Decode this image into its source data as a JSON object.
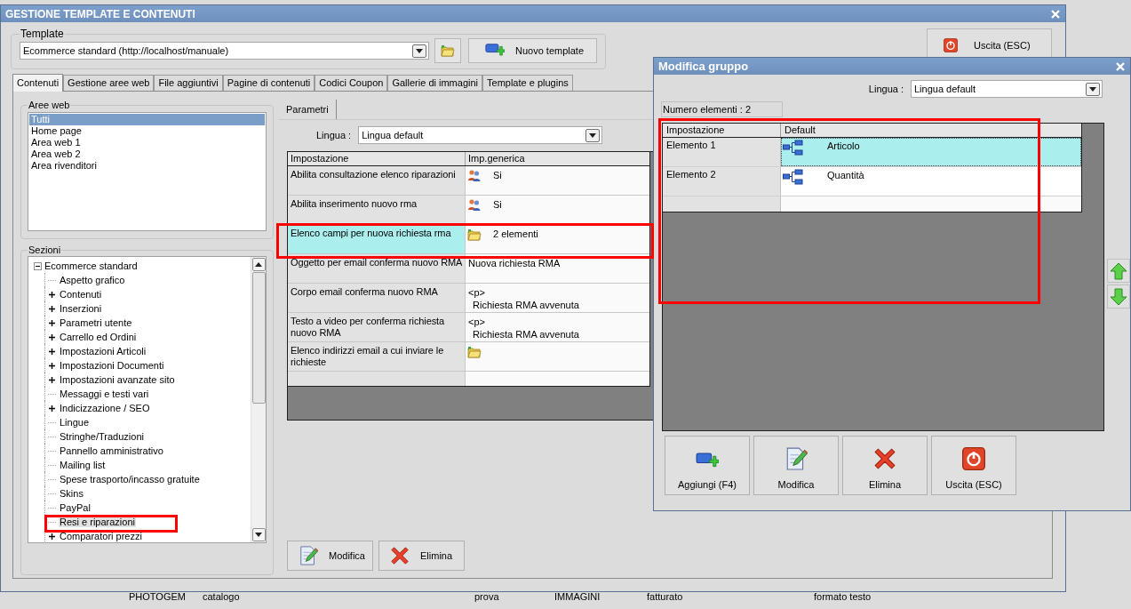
{
  "main_window": {
    "title": "GESTIONE TEMPLATE E CONTENUTI",
    "template": {
      "legend": "Template",
      "value": "Ecommerce standard (http://localhost/manuale)"
    },
    "new_template_button": "Nuovo template",
    "exit_button": "Uscita (ESC)",
    "tabs": [
      {
        "label": "Contenuti",
        "selected": true
      },
      {
        "label": "Gestione aree web",
        "selected": false
      },
      {
        "label": "File aggiuntivi",
        "selected": false
      },
      {
        "label": "Pagine di contenuti",
        "selected": false
      },
      {
        "label": "Codici Coupon",
        "selected": false
      },
      {
        "label": "Gallerie di immagini",
        "selected": false
      },
      {
        "label": "Template e plugins",
        "selected": false
      }
    ],
    "web_areas": {
      "legend": "Aree web",
      "items": [
        {
          "label": "Tutti",
          "selected": true
        },
        {
          "label": "Home page",
          "selected": false
        },
        {
          "label": "Area web 1",
          "selected": false
        },
        {
          "label": "Area web 2",
          "selected": false
        },
        {
          "label": "Area rivenditori",
          "selected": false
        }
      ]
    },
    "sections": {
      "legend": "Sezioni",
      "tree": [
        {
          "label": "Ecommerce standard",
          "expanded": true,
          "children": [
            {
              "label": "Aspetto grafico",
              "has_children": false,
              "selected": false
            },
            {
              "label": "Contenuti",
              "has_children": true,
              "selected": false
            },
            {
              "label": "Inserzioni",
              "has_children": true,
              "selected": false
            },
            {
              "label": "Parametri utente",
              "has_children": true,
              "selected": false
            },
            {
              "label": "Carrello ed Ordini",
              "has_children": true,
              "selected": false
            },
            {
              "label": "Impostazioni Articoli",
              "has_children": true,
              "selected": false
            },
            {
              "label": "Impostazioni Documenti",
              "has_children": true,
              "selected": false
            },
            {
              "label": "Impostazioni avanzate sito",
              "has_children": true,
              "selected": false
            },
            {
              "label": "Messaggi e testi vari",
              "has_children": false,
              "selected": false
            },
            {
              "label": "Indicizzazione / SEO",
              "has_children": true,
              "selected": false
            },
            {
              "label": "Lingue",
              "has_children": false,
              "selected": false
            },
            {
              "label": "Stringhe/Traduzioni",
              "has_children": false,
              "selected": false
            },
            {
              "label": "Pannello amministrativo",
              "has_children": false,
              "selected": false
            },
            {
              "label": "Mailing list",
              "has_children": false,
              "selected": false
            },
            {
              "label": "Spese trasporto/incasso gratuite",
              "has_children": false,
              "selected": false
            },
            {
              "label": "Skins",
              "has_children": false,
              "selected": false
            },
            {
              "label": "PayPal",
              "has_children": false,
              "selected": false
            },
            {
              "label": "Resi e riparazioni",
              "has_children": false,
              "selected": true
            },
            {
              "label": "Comparatori prezzi",
              "has_children": true,
              "selected": false
            }
          ]
        }
      ]
    },
    "parameters": {
      "tab": "Parametri",
      "language_label": "Lingua :",
      "language": "Lingua default",
      "columns": [
        "Impostazione",
        "Imp.generica"
      ],
      "rows": [
        {
          "setting": "Abilita consultazione elenco riparazioni",
          "kind": "users",
          "value_lines": [
            "Si"
          ],
          "selected": false
        },
        {
          "setting": "Abilita inserimento nuovo rma",
          "kind": "users",
          "value_lines": [
            "Si"
          ],
          "selected": false
        },
        {
          "setting": "Elenco campi per nuova richiesta rma",
          "kind": "list",
          "value_lines": [
            "2 elementi"
          ],
          "selected": true
        },
        {
          "setting": "Oggetto per email conferma nuovo RMA",
          "kind": "text",
          "value_lines": [
            "Nuova richiesta RMA"
          ],
          "selected": false
        },
        {
          "setting": "Corpo email conferma nuovo RMA",
          "kind": "text",
          "value_lines": [
            "<p>",
            "Richiesta RMA avvenuta"
          ],
          "selected": false
        },
        {
          "setting": "Testo a video per conferma richiesta nuovo RMA",
          "kind": "text",
          "value_lines": [
            "<p>",
            "Richiesta RMA avvenuta"
          ],
          "selected": false
        },
        {
          "setting": "Elenco indirizzi email a cui inviare le richieste",
          "kind": "list",
          "value_lines": [],
          "selected": false
        }
      ]
    },
    "actions": [
      {
        "kind": "edit",
        "label": "Modifica"
      },
      {
        "kind": "delete",
        "label": "Elimina"
      }
    ]
  },
  "dialog": {
    "title": "Modifica gruppo",
    "language_label": "Lingua :",
    "language": "Lingua default",
    "count": "Numero elementi : 2",
    "columns": [
      "Impostazione",
      "Default"
    ],
    "rows": [
      {
        "setting": "Elemento 1",
        "value": "Articolo",
        "selected": true
      },
      {
        "setting": "Elemento 2",
        "value": "Quantità",
        "selected": false
      }
    ],
    "actions": [
      {
        "kind": "add",
        "label": "Aggiungi (F4)"
      },
      {
        "kind": "edit",
        "label": "Modifica"
      },
      {
        "kind": "delete",
        "label": "Elimina"
      },
      {
        "kind": "exit",
        "label": "Uscita (ESC)"
      }
    ]
  },
  "desktop_labels": [
    "PHOTOGEM",
    "catalogo",
    "prova",
    "IMMAGINI",
    "fatturato",
    "formato testo"
  ]
}
